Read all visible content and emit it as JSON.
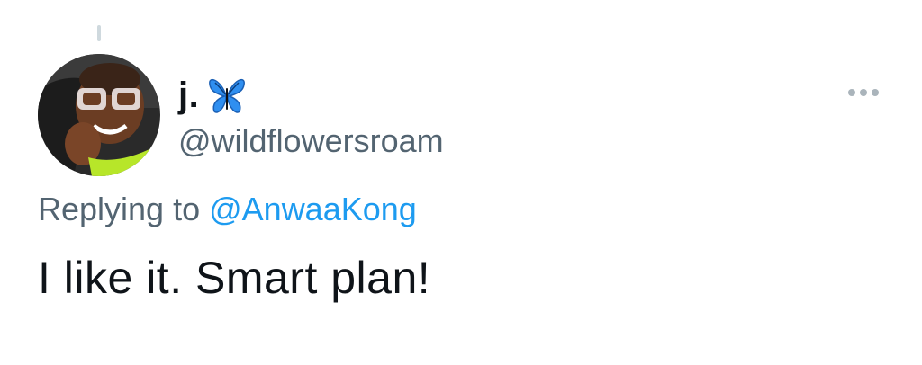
{
  "tweet": {
    "display_name": "j.",
    "badge_icon": "blue-butterfly-icon",
    "handle": "@wildflowersroam",
    "replying_prefix": "Replying to ",
    "replying_to": "@AnwaaKong",
    "text": "I like it. Smart plan!",
    "more_icon": "more-dots-icon"
  },
  "colors": {
    "name": "#0f1419",
    "secondary": "#536471",
    "link": "#1d9bf0",
    "thread_line": "#cfd9de",
    "butterfly": "#2f8ff0"
  }
}
